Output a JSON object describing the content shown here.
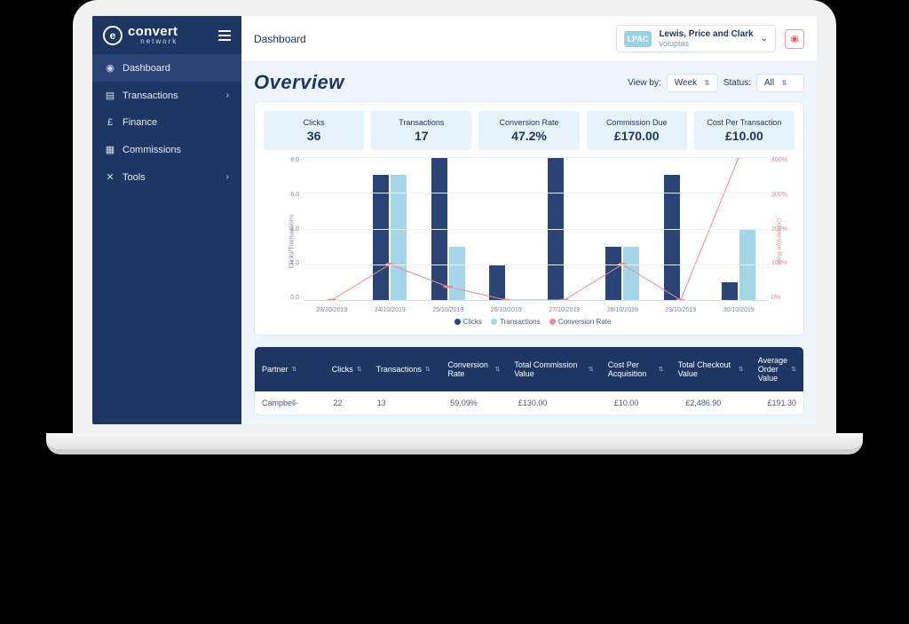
{
  "brand": {
    "name": "convert",
    "sub": "network"
  },
  "breadcrumb": "Dashboard",
  "account": {
    "badge": "LPAC",
    "name": "Lewis, Price and Clark",
    "sub": "voluptas"
  },
  "sidebar": {
    "items": [
      {
        "label": "Dashboard",
        "icon": "◉",
        "active": true,
        "expandable": false
      },
      {
        "label": "Transactions",
        "icon": "▤",
        "active": false,
        "expandable": true
      },
      {
        "label": "Finance",
        "icon": "£",
        "active": false,
        "expandable": false
      },
      {
        "label": "Commissions",
        "icon": "▦",
        "active": false,
        "expandable": false
      },
      {
        "label": "Tools",
        "icon": "✕",
        "active": false,
        "expandable": true
      }
    ]
  },
  "page": {
    "title": "Overview",
    "view_by_label": "View by:",
    "view_by_value": "Week",
    "status_label": "Status:",
    "status_value": "All"
  },
  "stats": [
    {
      "label": "Clicks",
      "value": "36"
    },
    {
      "label": "Transactions",
      "value": "17"
    },
    {
      "label": "Conversion Rate",
      "value": "47.2%"
    },
    {
      "label": "Commission Due",
      "value": "£170.00"
    },
    {
      "label": "Cost Per Transaction",
      "value": "£10.00"
    }
  ],
  "chart_data": {
    "type": "bar",
    "categories": [
      "23/10/2019",
      "24/10/2019",
      "25/10/2019",
      "26/10/2019",
      "27/10/2019",
      "28/10/2019",
      "29/10/2019",
      "30/10/2019"
    ],
    "series": [
      {
        "name": "Clicks",
        "values": [
          0,
          7,
          8,
          2,
          8,
          3,
          7,
          1
        ],
        "color": "#2b4478"
      },
      {
        "name": "Transactions",
        "values": [
          0,
          7,
          3,
          0,
          0,
          3,
          0,
          4
        ],
        "color": "#a4d6ea"
      },
      {
        "name": "Conversion Rate",
        "values": [
          0,
          100,
          37,
          0,
          0,
          100,
          0,
          400
        ],
        "color": "#ef8a8f",
        "axis": "right",
        "type": "line"
      }
    ],
    "ylabel_left": "Clicks/Transactions",
    "ylabel_right": "Conversion Rate",
    "ylim_left": [
      0,
      8
    ],
    "ylim_right": [
      0,
      400
    ],
    "y_ticks_left": [
      "8.0",
      "6.0",
      "4.0",
      "2.0",
      "0.0"
    ],
    "y_ticks_right": [
      "400%",
      "300%",
      "200%",
      "100%",
      "0%"
    ],
    "legend": [
      "Clicks",
      "Transactions",
      "Conversion Rate"
    ]
  },
  "table": {
    "columns": [
      "Partner",
      "Clicks",
      "Transactions",
      "Conversion Rate",
      "Total Commission Value",
      "Cost Per Acquisition",
      "Total Checkout Value",
      "Average Order Value"
    ],
    "rows": [
      [
        "Campbell-",
        "22",
        "13",
        "59.09%",
        "£130.00",
        "£10.00",
        "£2,486.90",
        "£191.30"
      ]
    ]
  }
}
